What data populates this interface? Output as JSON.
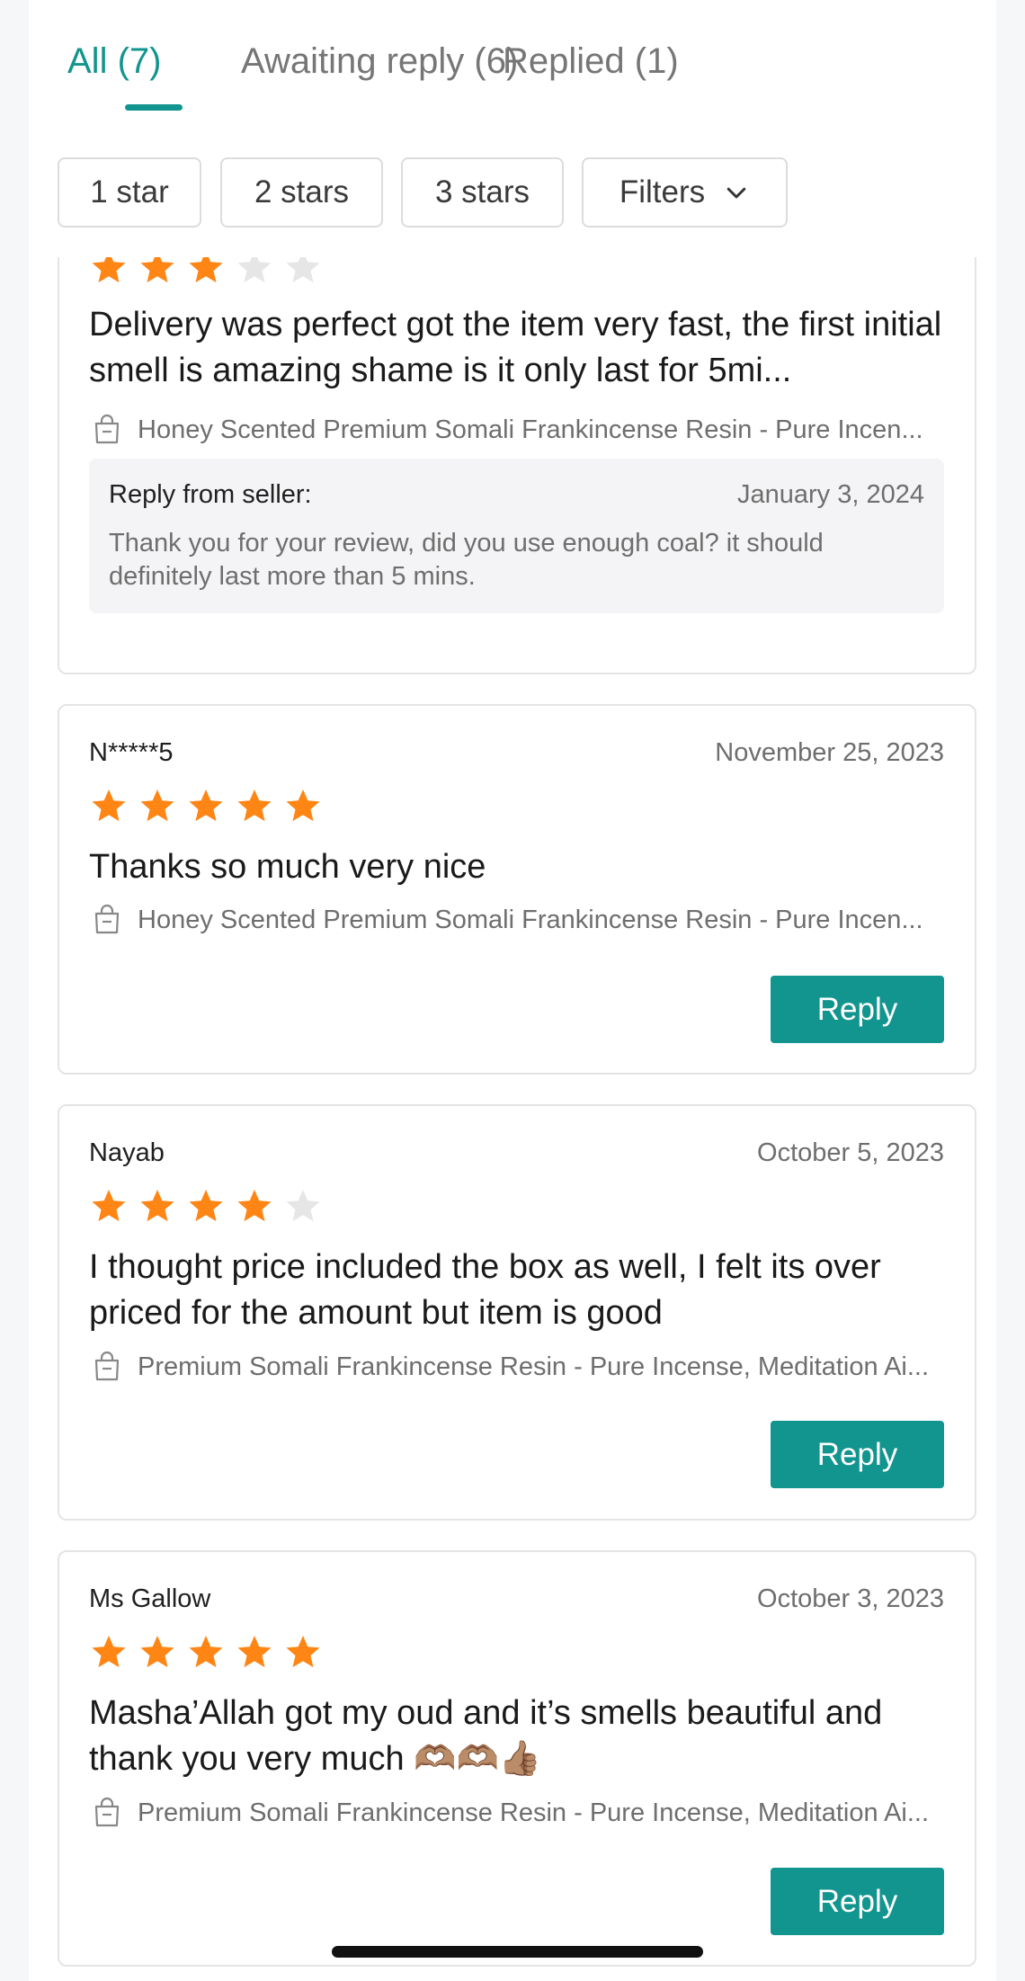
{
  "tabs": [
    {
      "label": "All (7)",
      "active": true
    },
    {
      "label": "Awaiting reply (6)",
      "active": false
    },
    {
      "label": "Replied (1)",
      "active": false
    }
  ],
  "filters": {
    "chips": [
      "1 star",
      "2 stars",
      "3 stars"
    ],
    "dropdown_label": "Filters",
    "dropdown_icon": "chevron-down-icon"
  },
  "colors": {
    "accent": "#12958f",
    "star_filled": "#ff8514",
    "star_empty": "#e6e6e6"
  },
  "reviews": [
    {
      "rating": 3,
      "text": "Delivery was perfect got the item very fast, the first initial smell is amazing shame is it only last for 5mi...",
      "product": "Honey Scented Premium Somali Frankincense Resin - Pure Incen...",
      "seller_reply": {
        "label": "Reply from seller:",
        "date": "January 3, 2024",
        "text": "Thank you for your review, did you use enough coal? it should definitely last more than 5 mins."
      }
    },
    {
      "reviewer": "N*****5",
      "date": "November 25, 2023",
      "rating": 5,
      "text": "Thanks so much very nice",
      "product": "Honey Scented Premium Somali Frankincense Resin - Pure Incen...",
      "reply_label": "Reply"
    },
    {
      "reviewer": "Nayab",
      "date": "October 5, 2023",
      "rating": 4,
      "text": "I thought price included the box as well, I felt its over priced for the amount but item is good",
      "product": "Premium Somali Frankincense Resin - Pure Incense, Meditation Ai...",
      "reply_label": "Reply"
    },
    {
      "reviewer": "Ms Gallow",
      "date": "October 3, 2023",
      "rating": 5,
      "text": "Masha’Allah got my oud and it’s smells beautiful and thank you very much 🫶🏽🫶🏽👍🏽",
      "product": "Premium Somali Frankincense Resin - Pure Incense, Meditation Ai...",
      "reply_label": "Reply"
    }
  ]
}
